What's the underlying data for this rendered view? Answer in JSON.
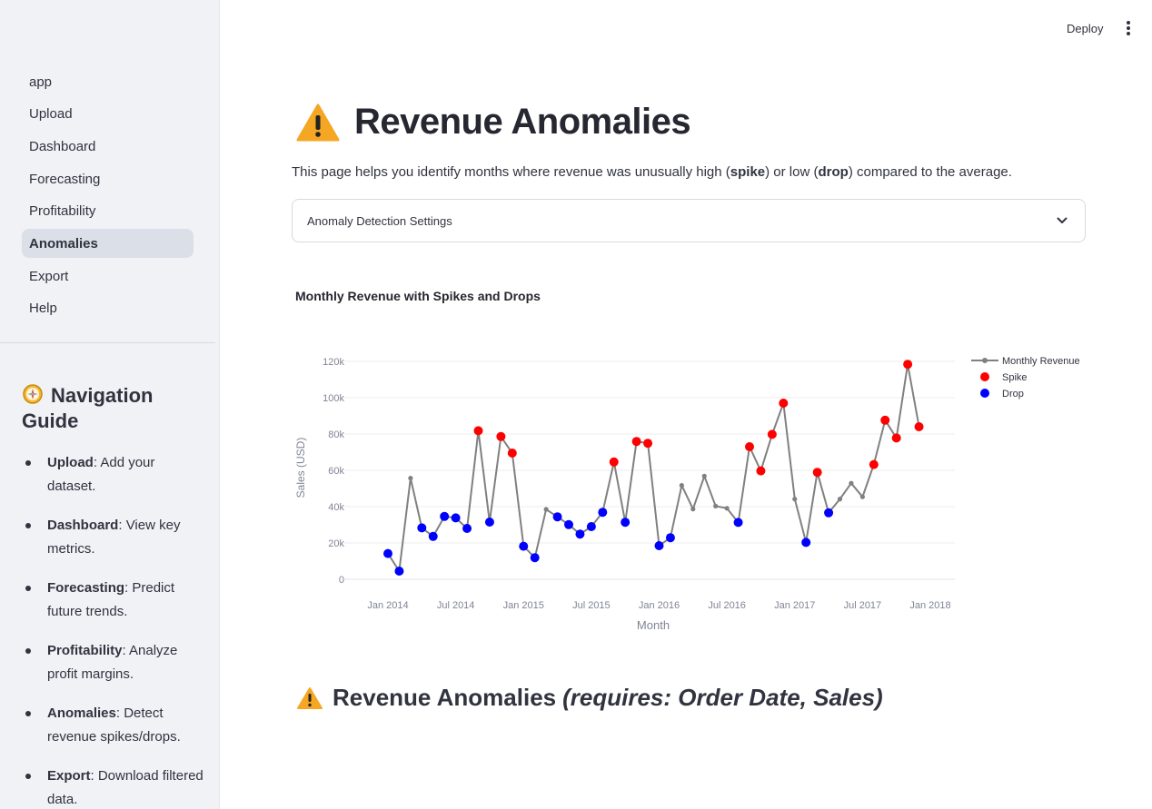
{
  "header": {
    "deploy_label": "Deploy",
    "menu_icon": "kebab-menu-icon"
  },
  "sidebar": {
    "items": [
      {
        "label": "app",
        "active": false
      },
      {
        "label": "Upload",
        "active": false
      },
      {
        "label": "Dashboard",
        "active": false
      },
      {
        "label": "Forecasting",
        "active": false
      },
      {
        "label": "Profitability",
        "active": false
      },
      {
        "label": "Anomalies",
        "active": true
      },
      {
        "label": "Export",
        "active": false
      },
      {
        "label": "Help",
        "active": false
      }
    ],
    "guide": {
      "title": "Navigation Guide",
      "icon": "compass-icon",
      "items": [
        {
          "term": "Upload",
          "desc": ": Add your dataset."
        },
        {
          "term": "Dashboard",
          "desc": ": View key metrics."
        },
        {
          "term": "Forecasting",
          "desc": ": Predict future trends."
        },
        {
          "term": "Profitability",
          "desc": ": Analyze profit margins."
        },
        {
          "term": "Anomalies",
          "desc": ": Detect revenue spikes/drops."
        },
        {
          "term": "Export",
          "desc": ": Download filtered data."
        }
      ]
    }
  },
  "main": {
    "title": "Revenue Anomalies",
    "title_icon": "warning-icon",
    "intro": {
      "p1": "This page helps you identify months where revenue was unusually high (",
      "b1": "spike",
      "p2": ") or low (",
      "b2": "drop",
      "p3": ") compared to the average."
    },
    "expander_label": "Anomaly Detection Settings",
    "section_title": "Revenue Anomalies",
    "section_subtitle": "(requires: Order Date, Sales)"
  },
  "colors": {
    "line": "#808080",
    "spike": "#ff0000",
    "drop": "#0000ff",
    "warning": "#f5a623"
  },
  "chart_data": {
    "type": "line",
    "title": "Monthly Revenue with Spikes and Drops",
    "xlabel": "Month",
    "ylabel": "Sales (USD)",
    "ylim": [
      0,
      120000
    ],
    "yticks": [
      0,
      20000,
      40000,
      60000,
      80000,
      100000,
      120000
    ],
    "ytick_labels": [
      "0",
      "20k",
      "40k",
      "60k",
      "80k",
      "100k",
      "120k"
    ],
    "xtick_labels": [
      "Jan 2014",
      "Jul 2014",
      "Jan 2015",
      "Jul 2015",
      "Jan 2016",
      "Jul 2016",
      "Jan 2017",
      "Jul 2017",
      "Jan 2018"
    ],
    "grid": true,
    "legend_position": "top-right",
    "legend": [
      "Monthly Revenue",
      "Spike",
      "Drop"
    ],
    "x": [
      "Jan 2014",
      "Feb 2014",
      "Mar 2014",
      "Apr 2014",
      "May 2014",
      "Jun 2014",
      "Jul 2014",
      "Aug 2014",
      "Sep 2014",
      "Oct 2014",
      "Nov 2014",
      "Dec 2014",
      "Jan 2015",
      "Feb 2015",
      "Mar 2015",
      "Apr 2015",
      "May 2015",
      "Jun 2015",
      "Jul 2015",
      "Aug 2015",
      "Sep 2015",
      "Oct 2015",
      "Nov 2015",
      "Dec 2015",
      "Jan 2016",
      "Feb 2016",
      "Mar 2016",
      "Apr 2016",
      "May 2016",
      "Jun 2016",
      "Jul 2016",
      "Aug 2016",
      "Sep 2016",
      "Oct 2016",
      "Nov 2016",
      "Dec 2016",
      "Jan 2017",
      "Feb 2017",
      "Mar 2017",
      "Apr 2017",
      "May 2017",
      "Jun 2017",
      "Jul 2017",
      "Aug 2017",
      "Sep 2017",
      "Oct 2017",
      "Nov 2017",
      "Dec 2017"
    ],
    "series": [
      {
        "name": "Monthly Revenue",
        "values": [
          14200,
          4500,
          55700,
          28300,
          23600,
          34600,
          33800,
          28000,
          81800,
          31500,
          78600,
          69500,
          18200,
          11900,
          38500,
          34400,
          30100,
          24900,
          29000,
          36900,
          64600,
          31400,
          75900,
          74900,
          18500,
          22900,
          51700,
          38700,
          56800,
          40300,
          39100,
          31300,
          73000,
          59700,
          79800,
          97000,
          44200,
          20300,
          58900,
          36600,
          44200,
          52900,
          45400,
          63200,
          87600,
          77800,
          118400,
          84000
        ]
      }
    ],
    "spike_months": [
      "Sep 2014",
      "Nov 2014",
      "Dec 2014",
      "Sep 2015",
      "Nov 2015",
      "Dec 2015",
      "Sep 2016",
      "Oct 2016",
      "Nov 2016",
      "Dec 2016",
      "Mar 2017",
      "Aug 2017",
      "Sep 2017",
      "Oct 2017",
      "Nov 2017",
      "Dec 2017"
    ],
    "drop_months": [
      "Jan 2014",
      "Feb 2014",
      "Apr 2014",
      "May 2014",
      "Jun 2014",
      "Jul 2014",
      "Aug 2014",
      "Oct 2014",
      "Jan 2015",
      "Feb 2015",
      "Apr 2015",
      "May 2015",
      "Jun 2015",
      "Jul 2015",
      "Aug 2015",
      "Oct 2015",
      "Jan 2016",
      "Feb 2016",
      "Aug 2016",
      "Feb 2017",
      "Apr 2017"
    ]
  }
}
